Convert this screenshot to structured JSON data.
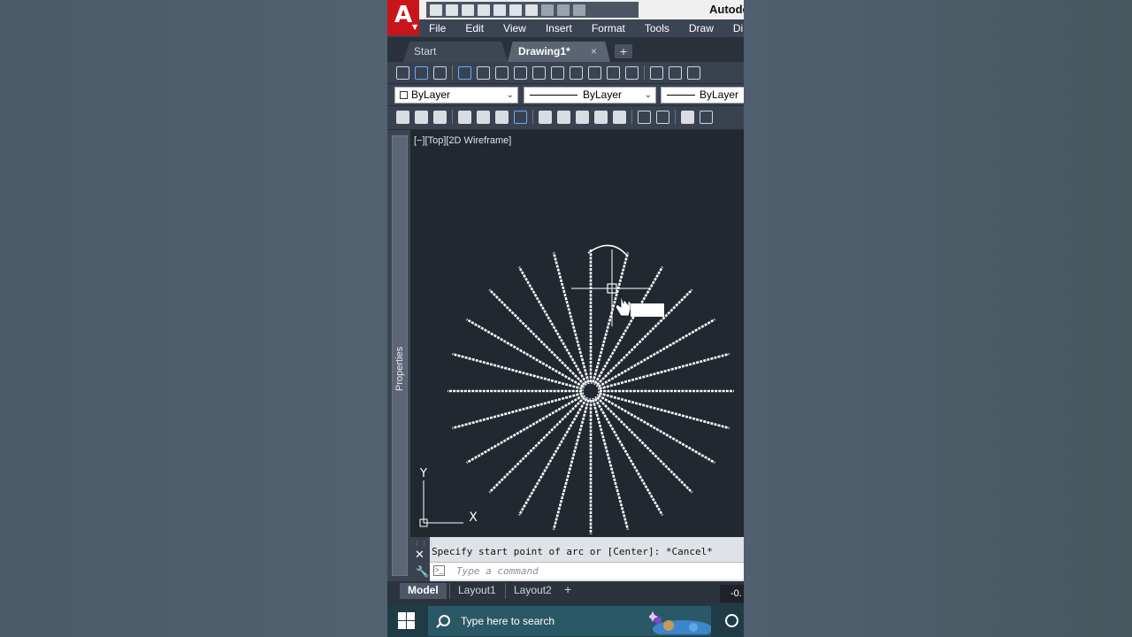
{
  "app": {
    "title": "Autodesk",
    "logo_letter": "A"
  },
  "menu": [
    "File",
    "Edit",
    "View",
    "Insert",
    "Format",
    "Tools",
    "Draw",
    "Di"
  ],
  "doc_tabs": {
    "start": "Start",
    "active": "Drawing1*",
    "close_glyph": "×",
    "add_glyph": "+"
  },
  "properties_bar": {
    "dropdown_color": "ByLayer",
    "dropdown_linetype": "ByLayer",
    "dropdown_lineweight": "ByLayer"
  },
  "palette": {
    "label": "Properties"
  },
  "viewport": {
    "label": "[−][Top][2D Wireframe]",
    "ucs_y": "Y",
    "ucs_x": "X"
  },
  "drawing": {
    "spoke_count": 24,
    "dashed_spokes": true,
    "color": "#ffffff"
  },
  "command_line": {
    "history": "Specify start point of arc or [Center]: *Cancel*",
    "placeholder": "Type a command"
  },
  "layout_tabs": [
    "Model",
    "Layout1",
    "Layout2"
  ],
  "status": {
    "coordinate": "-0."
  },
  "taskbar": {
    "search_placeholder": "Type here to search"
  },
  "colors": {
    "accent": "#c8151b",
    "viewport_bg": "#212830",
    "ui_dark": "#3b4453"
  }
}
